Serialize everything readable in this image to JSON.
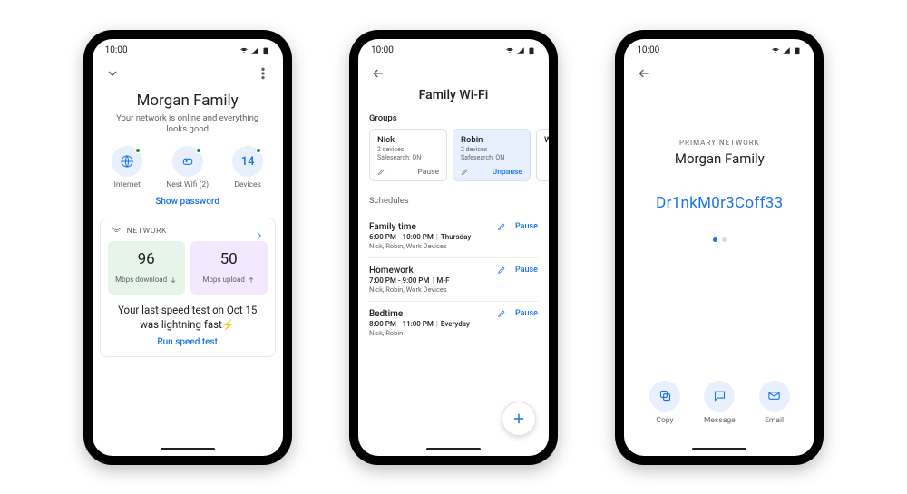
{
  "status_time": "10:00",
  "phone1": {
    "title": "Morgan Family",
    "subtitle": "Your network is online and everything looks good",
    "tiles": {
      "internet": "Internet",
      "nest": "Nest Wifi (2)",
      "devices_count": "14",
      "devices": "Devices"
    },
    "show_password": "Show password",
    "network_label": "NETWORK",
    "download_value": "96",
    "download_label": "Mbps download",
    "upload_value": "50",
    "upload_label": "Mbps upload",
    "speed_message": "Your last speed test on Oct 15 was lightning fast⚡",
    "run_speed_test": "Run speed test"
  },
  "phone2": {
    "title": "Family Wi-Fi",
    "groups_label": "Groups",
    "groups": [
      {
        "name": "Nick",
        "devices": "2 devices",
        "safesearch": "Safesearch: ON",
        "action": "Pause"
      },
      {
        "name": "Robin",
        "devices": "2 devices",
        "safesearch": "Safesearch: ON",
        "action": "Unpause"
      },
      {
        "name": "W",
        "devices": "",
        "safesearch": "",
        "action": ""
      }
    ],
    "schedules_label": "Schedules",
    "schedules": [
      {
        "name": "Family time",
        "time": "6:00 PM - 10:00 PM",
        "days": "Thursday",
        "devices": "Nick, Robin, Work Devices",
        "pause": "Pause"
      },
      {
        "name": "Homework",
        "time": "7:00 PM - 9:00 PM",
        "days": "M-F",
        "devices": "Nick, Robin, Work Devices",
        "pause": "Pause"
      },
      {
        "name": "Bedtime",
        "time": "8:00 PM - 11:00 PM",
        "days": "Everyday",
        "devices": "Nick, Robin",
        "pause": "Pause"
      }
    ]
  },
  "phone3": {
    "overline": "PRIMARY NETWORK",
    "name": "Morgan Family",
    "password": "Dr1nkM0r3Coff33",
    "actions": {
      "copy": "Copy",
      "message": "Message",
      "email": "Email"
    }
  }
}
